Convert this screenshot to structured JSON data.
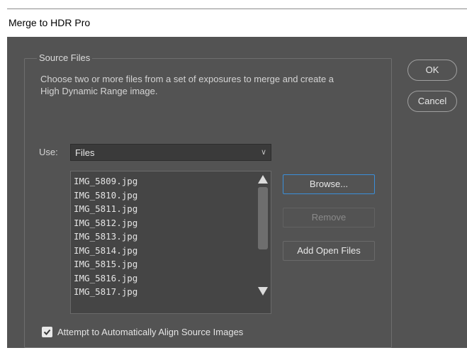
{
  "window": {
    "title": "Merge to HDR Pro"
  },
  "source_files": {
    "legend": "Source Files",
    "description": "Choose two or more files from a set of exposures to merge and create a High Dynamic Range image.",
    "use_label": "Use:",
    "use_value": "Files",
    "files": [
      "IMG_5809.jpg",
      "IMG_5810.jpg",
      "IMG_5811.jpg",
      "IMG_5812.jpg",
      "IMG_5813.jpg",
      "IMG_5814.jpg",
      "IMG_5815.jpg",
      "IMG_5816.jpg",
      "IMG_5817.jpg"
    ],
    "browse_label": "Browse...",
    "remove_label": "Remove",
    "add_open_label": "Add Open Files",
    "align_label": "Attempt to Automatically Align Source Images",
    "align_checked": true
  },
  "actions": {
    "ok_label": "OK",
    "cancel_label": "Cancel"
  },
  "colors": {
    "panel": "#535353",
    "focus_border": "#3b8fd9"
  }
}
